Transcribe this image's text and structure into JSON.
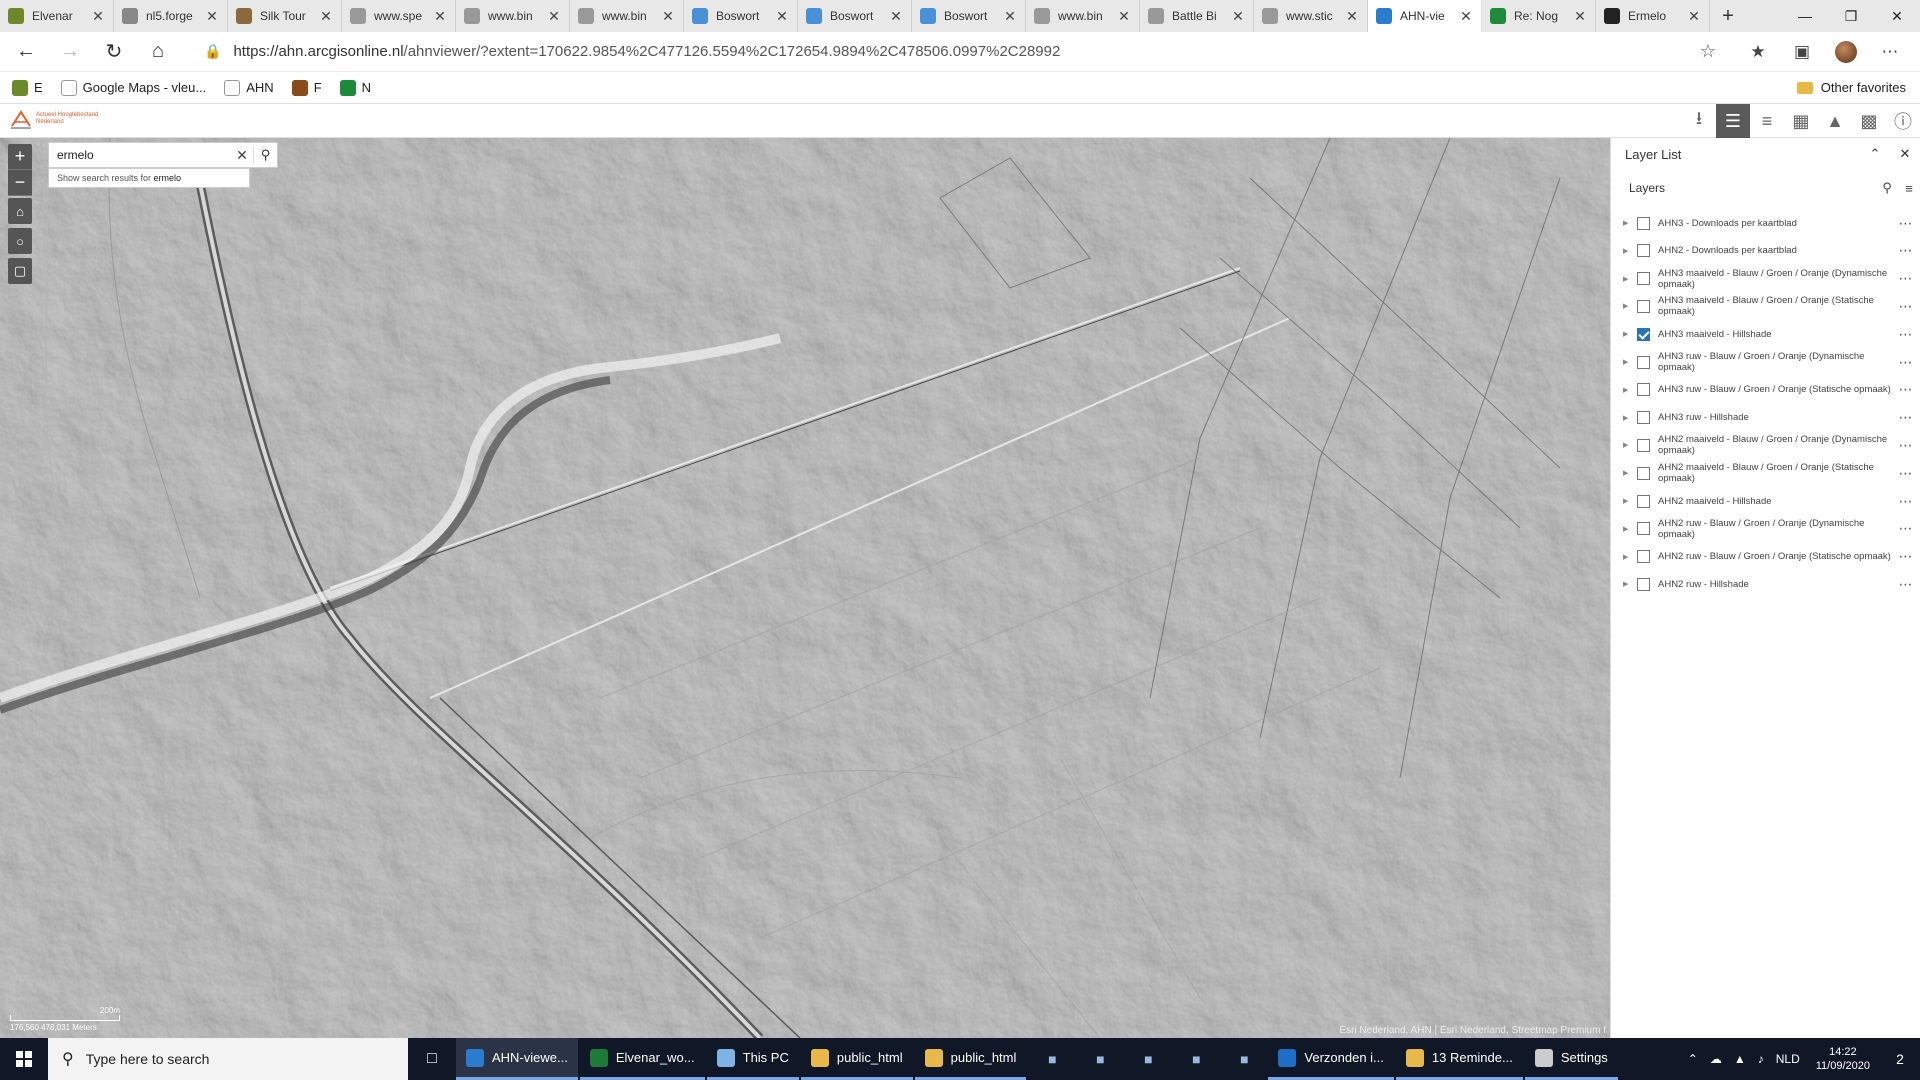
{
  "tabs": [
    {
      "title": "Elvenar",
      "color": "#6b8a2b"
    },
    {
      "title": "nl5.forge",
      "color": "#888888"
    },
    {
      "title": "Silk Tour",
      "color": "#8a6a3a"
    },
    {
      "title": "www.spe",
      "color": "#999999"
    },
    {
      "title": "www.bin",
      "color": "#999999"
    },
    {
      "title": "www.bin",
      "color": "#999999"
    },
    {
      "title": "Boswort",
      "color": "#4a90d9"
    },
    {
      "title": "Boswort",
      "color": "#4a90d9"
    },
    {
      "title": "Boswort",
      "color": "#4a90d9"
    },
    {
      "title": "www.bin",
      "color": "#999999"
    },
    {
      "title": "Battle Bi",
      "color": "#999999"
    },
    {
      "title": "www.stic",
      "color": "#999999"
    },
    {
      "title": "AHN-vie",
      "color": "#2b7ccf"
    },
    {
      "title": "Re: Nog",
      "color": "#1f8a3a"
    },
    {
      "title": "Ermelo",
      "color": "#222222"
    }
  ],
  "address": {
    "host": "https://ahn.arcgisonline.nl",
    "path": "/ahnviewer/?extent=170622.9854%2C477126.5594%2C172654.9894%2C478506.0997%2C28992"
  },
  "favorites": [
    {
      "label": "E",
      "color": "#6b8a2b"
    },
    {
      "label": "Google Maps - vleu...",
      "color": "#ffffff"
    },
    {
      "label": "AHN",
      "color": "#ffffff"
    },
    {
      "label": "F",
      "color": "#8a4a1a"
    },
    {
      "label": "N",
      "color": "#1f8a3a"
    }
  ],
  "favorites_other": "Other favorites",
  "app": {
    "logo_line1": "Actueel Hoogtebestand",
    "logo_line2": "Nederland"
  },
  "search": {
    "value": "ermelo",
    "suggest_prefix": "Show search results for ",
    "suggest_term": "ermelo"
  },
  "map": {
    "scale_label": "200m",
    "coords": "176,560 478,031 Meters",
    "attribution": "Esri Nederland, AHN | Esri Nederland, Streetmap Premium f"
  },
  "panel": {
    "title": "Layer List",
    "subtitle": "Layers",
    "layers": [
      {
        "label": "AHN3 - Downloads per kaartblad",
        "checked": false
      },
      {
        "label": "AHN2 - Downloads per kaartblad",
        "checked": false
      },
      {
        "label": "AHN3 maaiveld - Blauw / Groen / Oranje (Dynamische opmaak)",
        "checked": false
      },
      {
        "label": "AHN3 maaiveld - Blauw / Groen / Oranje (Statische opmaak)",
        "checked": false
      },
      {
        "label": "AHN3 maaiveld - Hillshade",
        "checked": true
      },
      {
        "label": "AHN3 ruw - Blauw / Groen / Oranje (Dynamische opmaak)",
        "checked": false
      },
      {
        "label": "AHN3 ruw - Blauw / Groen / Oranje (Statische opmaak)",
        "checked": false
      },
      {
        "label": "AHN3 ruw - Hillshade",
        "checked": false
      },
      {
        "label": "AHN2 maaiveld - Blauw / Groen / Oranje (Dynamische opmaak)",
        "checked": false
      },
      {
        "label": "AHN2 maaiveld - Blauw / Groen / Oranje (Statische opmaak)",
        "checked": false
      },
      {
        "label": "AHN2 maaiveld - Hillshade",
        "checked": false
      },
      {
        "label": "AHN2 ruw - Blauw / Groen / Oranje (Dynamische opmaak)",
        "checked": false
      },
      {
        "label": "AHN2 ruw - Blauw / Groen / Oranje (Statische opmaak)",
        "checked": false
      },
      {
        "label": "AHN2 ruw - Hillshade",
        "checked": false
      }
    ]
  },
  "taskbar": {
    "search_placeholder": "Type here to search",
    "apps": [
      {
        "label": "AHN-viewe...",
        "color": "#2b7ccf",
        "active": true
      },
      {
        "label": "Elvenar_wo...",
        "color": "#1f7a3a",
        "active": false
      },
      {
        "label": "This PC",
        "color": "#7fb3e6",
        "active": false
      },
      {
        "label": "public_html",
        "color": "#e8b84a",
        "active": false
      },
      {
        "label": "public_html",
        "color": "#e8b84a",
        "active": false
      }
    ],
    "apps2": [
      {
        "label": "Verzonden i...",
        "color": "#1f6fc7",
        "active": false
      },
      {
        "label": "13 Reminde...",
        "color": "#e8b84a",
        "active": false
      },
      {
        "label": "Settings",
        "color": "#cccccc",
        "active": false
      }
    ],
    "language": "NLD",
    "time": "14:22",
    "date": "11/09/2020",
    "notifications": "2"
  }
}
